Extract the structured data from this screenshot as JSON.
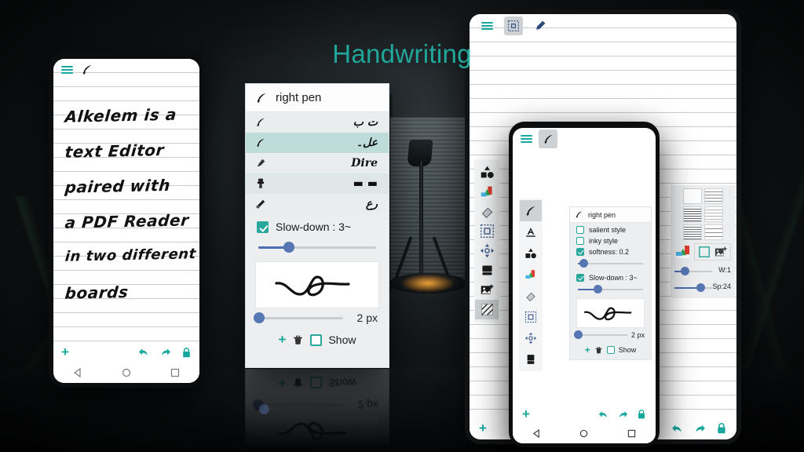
{
  "title": "Handwriting",
  "theme": {
    "accent": "#22a79b",
    "teal_icon": "#17a9a0",
    "slider_blue": "#5777b3",
    "selected_row": "#bedcd9"
  },
  "left_phone": {
    "topbar": {
      "menu_icon": "hamburger-menu-icon",
      "pen_icon": "quill-pen-icon"
    },
    "handwriting_lines": [
      "Alkelem is a",
      "text Editor",
      "paired with",
      "a PDF Reader",
      "in two different",
      "boards"
    ],
    "bottom_bar": {
      "add_label": "+",
      "undo_icon": "undo-arrow-icon",
      "redo_icon": "redo-arrow-icon",
      "lock_icon": "lock-icon"
    },
    "nav_bar": {
      "back": "back-triangle-icon",
      "home": "home-circle-icon",
      "recents": "recents-square-icon"
    }
  },
  "pen_panel": {
    "header_title": "right pen",
    "header_icon": "quill-pen-icon",
    "pen_rows": [
      {
        "icon": "quill-pen-icon",
        "sample": "ت ب",
        "selected": false
      },
      {
        "icon": "quill-pen-icon",
        "sample": "عل۔",
        "selected": true
      },
      {
        "icon": "marker-pen-icon",
        "sample": "Dire",
        "selected": false
      },
      {
        "icon": "brush-pen-icon",
        "sample": "▬ ▬",
        "selected": false
      },
      {
        "icon": "calligraphy-pen-icon",
        "sample": "رع",
        "selected": false
      }
    ],
    "slowdown": {
      "label": "Slow-down : 3~",
      "checked": true,
      "slider_percent": 26
    },
    "preview_glyph": "handwritten-stroke-preview",
    "width": {
      "label": "2 px",
      "slider_percent": 3
    },
    "footer": {
      "add_label": "+",
      "delete_icon": "trash-icon",
      "show_label": "Show",
      "show_checked": false
    }
  },
  "tablet": {
    "topbar": {
      "menu_icon": "hamburger-menu-icon",
      "select_icon": "selection-frame-icon",
      "pencil_icon": "pencil-icon",
      "select_active": true
    },
    "tools": [
      {
        "name": "shapes-tool-icon",
        "active": false
      },
      {
        "name": "color-palette-tool-icon",
        "active": false
      },
      {
        "name": "eraser-tool-icon",
        "active": false
      },
      {
        "name": "select-tool-icon",
        "active": false
      },
      {
        "name": "move-tool-icon",
        "active": false
      },
      {
        "name": "keyboard-tool-icon",
        "active": false
      },
      {
        "name": "insert-image-tool-icon",
        "active": false
      },
      {
        "name": "pattern-tool-icon",
        "active": true
      }
    ],
    "paper_panel": {
      "styles": [
        "blank-paper-icon",
        "wide-lines-paper-icon",
        "narrow-lines-paper-icon",
        "light-grid-paper-icon",
        "dense-grid-paper-icon",
        "square-grid-paper-icon"
      ],
      "actions": [
        "color-palette-icon",
        "frame-color-icon",
        "insert-image-icon"
      ],
      "width_slider": {
        "label": "W:1",
        "percent": 22
      },
      "spacing_slider": {
        "label": "Sp:24",
        "percent": 62
      }
    },
    "bottom_bar": {
      "add_label": "+",
      "undo_icon": "undo-arrow-icon",
      "redo_icon": "redo-arrow-icon",
      "lock_icon": "lock-icon"
    }
  },
  "overlay_phone": {
    "topbar": {
      "menu_icon": "hamburger-menu-icon",
      "pen_icon": "quill-pen-icon"
    },
    "tools": [
      {
        "name": "pen-tool-icon",
        "active": true
      },
      {
        "name": "text-tool-icon",
        "active": false
      },
      {
        "name": "shapes-tool-icon",
        "active": false
      },
      {
        "name": "color-palette-tool-icon",
        "active": false
      },
      {
        "name": "eraser-tool-icon",
        "active": false
      },
      {
        "name": "select-tool-icon",
        "active": false
      },
      {
        "name": "move-tool-icon",
        "active": false
      },
      {
        "name": "keyboard-tool-icon",
        "active": false
      }
    ],
    "panel": {
      "header_title": "right pen",
      "header_icon": "quill-pen-icon",
      "options": [
        {
          "label": "salient style",
          "checked": false
        },
        {
          "label": "inky style",
          "checked": false
        },
        {
          "label": "softness: 0.2",
          "checked": true
        }
      ],
      "softness_slider_percent": 8,
      "slowdown": {
        "label": "Slow-down : 3~",
        "checked": true,
        "slider_percent": 30
      },
      "preview_glyph": "handwritten-stroke-preview",
      "width": {
        "label": "2 px",
        "slider_percent": 3
      },
      "footer": {
        "add_label": "+",
        "delete_icon": "trash-icon",
        "show_label": "Show",
        "show_checked": false
      }
    },
    "bottom_bar": {
      "add_label": "+",
      "undo_icon": "undo-arrow-icon",
      "redo_icon": "redo-arrow-icon",
      "lock_icon": "lock-icon"
    },
    "nav_bar": {
      "back": "back-triangle-icon",
      "home": "home-circle-icon",
      "recents": "recents-square-icon"
    }
  },
  "reflection": {
    "show_label": "Show",
    "px_label": "2 px"
  }
}
